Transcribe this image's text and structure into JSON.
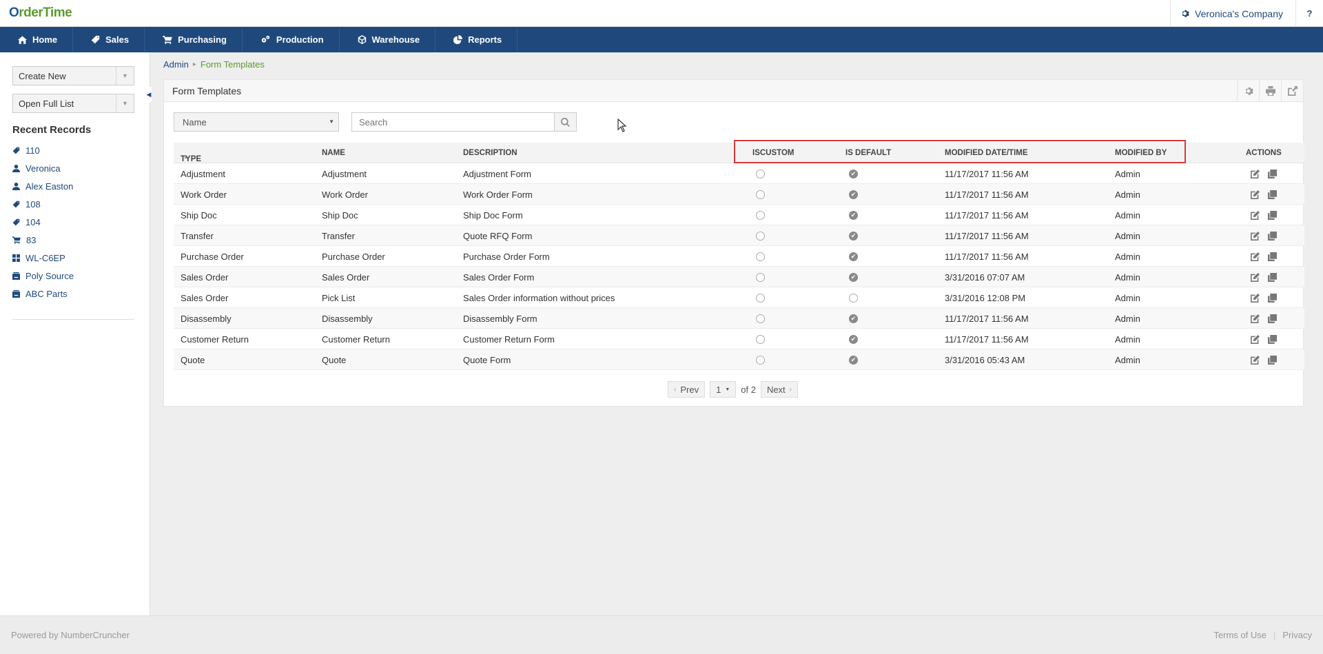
{
  "app": {
    "logo_first": "O",
    "logo_rest": "rderTime",
    "company": "Veronica's Company",
    "help": "?"
  },
  "nav": [
    {
      "label": "Home",
      "icon": "home-icon"
    },
    {
      "label": "Sales",
      "icon": "tag-icon"
    },
    {
      "label": "Purchasing",
      "icon": "cart-icon"
    },
    {
      "label": "Production",
      "icon": "gears-icon"
    },
    {
      "label": "Warehouse",
      "icon": "cube-icon"
    },
    {
      "label": "Reports",
      "icon": "pie-chart-icon"
    }
  ],
  "sidebar": {
    "create_new": "Create New",
    "open_full_list": "Open Full List",
    "recent_title": "Recent Records",
    "recent": [
      {
        "label": "110",
        "icon": "tag-icon"
      },
      {
        "label": "Veronica",
        "icon": "user-icon"
      },
      {
        "label": "Alex Easton",
        "icon": "user-icon"
      },
      {
        "label": "108",
        "icon": "tag-icon"
      },
      {
        "label": "104",
        "icon": "tag-icon"
      },
      {
        "label": "83",
        "icon": "cart-icon"
      },
      {
        "label": "WL-C6EP",
        "icon": "grid-icon"
      },
      {
        "label": "Poly Source",
        "icon": "building-icon"
      },
      {
        "label": "ABC Parts",
        "icon": "building-icon"
      }
    ]
  },
  "breadcrumb": {
    "parent": "Admin",
    "current": "Form Templates"
  },
  "panel": {
    "title": "Form Templates",
    "filter_field": "Name",
    "search_placeholder": "Search"
  },
  "table": {
    "columns": {
      "type": "TYPE",
      "name": "NAME",
      "description": "DESCRIPTION",
      "iscustom": "ISCUSTOM",
      "is_default": "IS DEFAULT",
      "modified": "MODIFIED DATE/TIME",
      "modified_by": "MODIFIED BY",
      "actions": "ACTIONS"
    },
    "sort_indicator": "▲",
    "rows": [
      {
        "type": "Adjustment",
        "name": "Adjustment",
        "description": "Adjustment Form",
        "iscustom": false,
        "is_default": true,
        "modified": "11/17/2017 11:56 AM",
        "modified_by": "Admin"
      },
      {
        "type": "Work Order",
        "name": "Work Order",
        "description": "Work Order Form",
        "iscustom": false,
        "is_default": true,
        "modified": "11/17/2017 11:56 AM",
        "modified_by": "Admin"
      },
      {
        "type": "Ship Doc",
        "name": "Ship Doc",
        "description": "Ship Doc Form",
        "iscustom": false,
        "is_default": true,
        "modified": "11/17/2017 11:56 AM",
        "modified_by": "Admin"
      },
      {
        "type": "Transfer",
        "name": "Transfer",
        "description": "Quote RFQ Form",
        "iscustom": false,
        "is_default": true,
        "modified": "11/17/2017 11:56 AM",
        "modified_by": "Admin"
      },
      {
        "type": "Purchase Order",
        "name": "Purchase Order",
        "description": "Purchase Order Form",
        "iscustom": false,
        "is_default": true,
        "modified": "11/17/2017 11:56 AM",
        "modified_by": "Admin"
      },
      {
        "type": "Sales Order",
        "name": "Sales Order",
        "description": "Sales Order Form",
        "iscustom": false,
        "is_default": true,
        "modified": "3/31/2016 07:07 AM",
        "modified_by": "Admin"
      },
      {
        "type": "Sales Order",
        "name": "Pick List",
        "description": "Sales Order information without prices",
        "iscustom": false,
        "is_default": false,
        "modified": "3/31/2016 12:08 PM",
        "modified_by": "Admin"
      },
      {
        "type": "Disassembly",
        "name": "Disassembly",
        "description": "Disassembly Form",
        "iscustom": false,
        "is_default": true,
        "modified": "11/17/2017 11:56 AM",
        "modified_by": "Admin"
      },
      {
        "type": "Customer Return",
        "name": "Customer Return",
        "description": "Customer Return Form",
        "iscustom": false,
        "is_default": true,
        "modified": "11/17/2017 11:56 AM",
        "modified_by": "Admin"
      },
      {
        "type": "Quote",
        "name": "Quote",
        "description": "Quote Form",
        "iscustom": false,
        "is_default": true,
        "modified": "3/31/2016 05:43 AM",
        "modified_by": "Admin"
      }
    ]
  },
  "pager": {
    "prev": "Prev",
    "page": "1",
    "of": "of 2",
    "next": "Next"
  },
  "footer": {
    "powered_by": "Powered by NumberCruncher",
    "terms": "Terms of Use",
    "privacy": "Privacy"
  },
  "colors": {
    "nav_bg": "#1f497d",
    "brand_green": "#5a9b2f",
    "highlight_box": "#d9373b"
  }
}
